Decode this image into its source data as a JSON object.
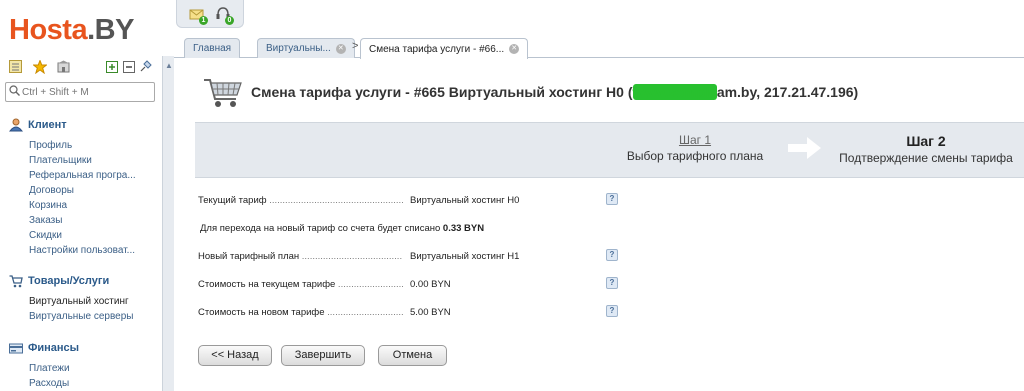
{
  "logo": {
    "part1": "Hosta",
    "part2": ".BY"
  },
  "sidebar": {
    "search_placeholder": "Ctrl + Shift + M",
    "groups": [
      {
        "title": "Клиент",
        "icon": "person-icon",
        "items": [
          "Профиль",
          "Плательщики",
          "Реферальная програ...",
          "Договоры",
          "Корзина",
          "Заказы",
          "Скидки",
          "Настройки пользоват..."
        ]
      },
      {
        "title": "Товары/Услуги",
        "icon": "cart-icon",
        "items": [
          "Виртуальный хостинг",
          "Виртуальные серверы"
        ]
      },
      {
        "title": "Финансы",
        "icon": "finance-icon",
        "items": [
          "Платежи",
          "Расходы"
        ]
      }
    ]
  },
  "tabs": [
    {
      "label": "Главная"
    },
    {
      "label": "Виртуальны..."
    },
    {
      "label": "Смена тарифа услуги - #66..."
    }
  ],
  "toolbar": {
    "badge1": "1",
    "badge2": "0"
  },
  "main": {
    "title_prefix": "Смена тарифа услуги - #665 Виртуальный хостинг H0 (",
    "title_blur": "www.sample",
    "title_suffix": "am.by, 217.21.47.196)",
    "wizard": {
      "step1_no": "Шаг 1",
      "step1_desc": "Выбор тарифного плана",
      "step2_no": "Шаг 2",
      "step2_desc": "Подтверждение смены тарифа"
    },
    "rows": [
      {
        "label": "Текущий тариф",
        "value": "Виртуальный хостинг H0"
      },
      {
        "label": "Новый тарифный план",
        "value": "Виртуальный хостинг H1"
      },
      {
        "label": "Стоимость на текущем тарифе",
        "value": "0.00 BYN"
      },
      {
        "label": "Стоимость на новом тарифе",
        "value": "5.00 BYN"
      }
    ],
    "note_text": "Для перехода на новый тариф со счета будет списано",
    "note_amount": "0.33 BYN",
    "help_glyph": "?"
  },
  "buttons": {
    "back": "<< Назад",
    "finish": "Завершить",
    "cancel": "Отмена"
  },
  "colors": {
    "brand_orange": "#e8541e",
    "link_blue": "#3b5f86",
    "wizard_bg": "#e5e9ee"
  }
}
